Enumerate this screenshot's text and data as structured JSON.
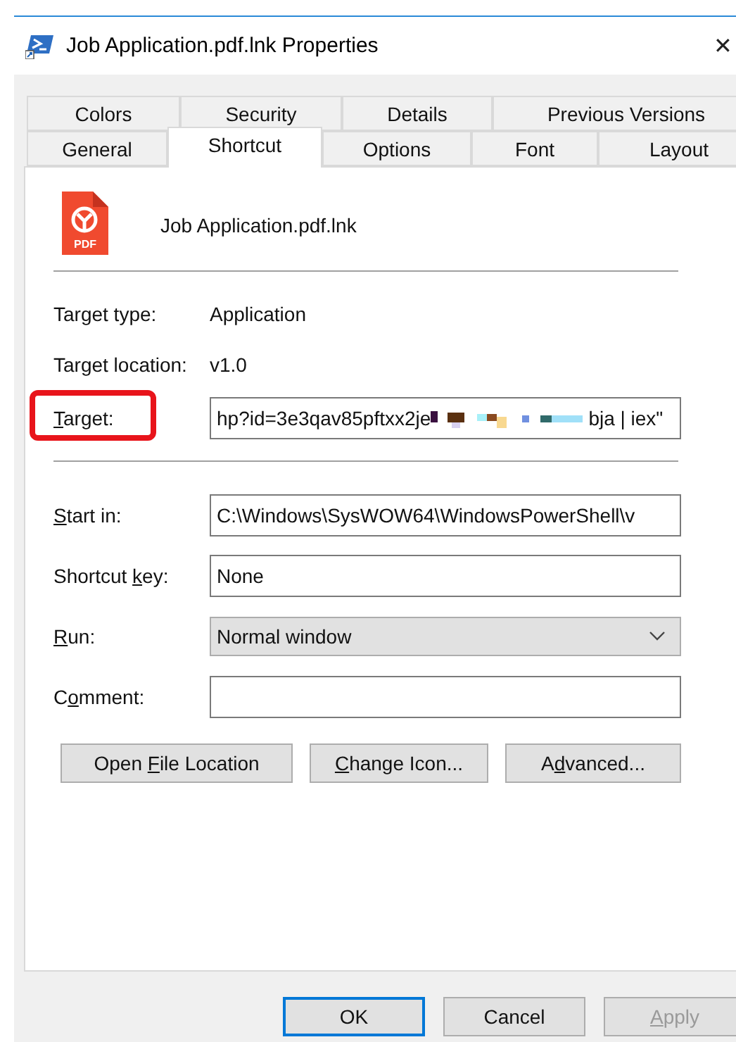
{
  "window": {
    "title": "Job Application.pdf.lnk Properties",
    "close": "✕"
  },
  "tab_rows": [
    {
      "tabs": [
        {
          "label": "Colors",
          "selected": false
        },
        {
          "label": "Security",
          "selected": false
        },
        {
          "label": "Details",
          "selected": false
        },
        {
          "label": "Previous Versions",
          "selected": false
        }
      ]
    },
    {
      "tabs": [
        {
          "label": "General",
          "selected": false
        },
        {
          "label": "Shortcut",
          "selected": true
        },
        {
          "label": "Options",
          "selected": false
        },
        {
          "label": "Font",
          "selected": false
        },
        {
          "label": "Layout",
          "selected": false
        }
      ]
    }
  ],
  "file": {
    "name": "Job Application.pdf.lnk",
    "icon_label": "PDF"
  },
  "info_rows": [
    {
      "label": "Target type:",
      "value": "Application"
    },
    {
      "label": "Target location:",
      "value": "v1.0"
    }
  ],
  "target": {
    "label": {
      "key": "T",
      "after": "arget:"
    },
    "value_start": "hp?id=3e3qav85pftxx2je",
    "value_end": "bja | iex\"",
    "highlighted": true
  },
  "fields": [
    {
      "kind": "text",
      "label": {
        "key": "S",
        "after": "tart in:"
      },
      "value": "C:\\Windows\\SysWOW64\\WindowsPowerShell\\v"
    },
    {
      "kind": "text",
      "label": {
        "before": "Shortcut ",
        "key": "k",
        "after": "ey:"
      },
      "value": "None"
    },
    {
      "kind": "select",
      "label": {
        "key": "R",
        "after": "un:"
      },
      "value": "Normal window"
    },
    {
      "kind": "text",
      "label": {
        "before": "C",
        "key": "o",
        "after": "mment:"
      }
    }
  ],
  "actions": [
    {
      "before": "Open ",
      "key": "F",
      "after": "ile Location"
    },
    {
      "key": "C",
      "after": "hange Icon..."
    },
    {
      "before": "A",
      "key": "d",
      "after": "vanced..."
    }
  ],
  "footer_buttons": [
    {
      "label": {
        "before": "OK"
      },
      "default": true,
      "disabled": false
    },
    {
      "label": {
        "before": "Cancel"
      },
      "default": false,
      "disabled": false
    },
    {
      "label": {
        "key": "A",
        "after": "pply"
      },
      "default": false,
      "disabled": true
    }
  ]
}
